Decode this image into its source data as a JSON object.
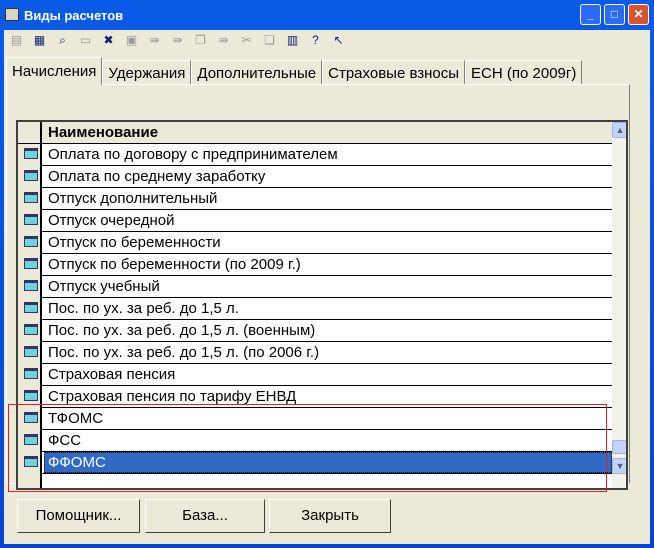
{
  "window": {
    "title": "Виды расчетов",
    "min": "_",
    "max": "□",
    "close": "✕"
  },
  "toolbar": [
    "new-icon",
    "edit-icon",
    "find-icon",
    "add-icon",
    "delete-icon",
    "copy-icon",
    "move-icon",
    "move-group-icon",
    "group-icon",
    "move-to-icon",
    "unlink-icon",
    "paste-icon",
    "print-icon",
    "help-icon",
    "whats-this-icon"
  ],
  "tabs": [
    "Начисления",
    "Удержания",
    "Дополнительные",
    "Страховые взносы",
    "ЕСН (по 2009г)"
  ],
  "grid": {
    "header": "Наименование",
    "rows": [
      "Оплата по договору с предпринимателем",
      "Оплата по среднему заработку",
      "Отпуск дополнительный",
      "Отпуск очередной",
      "Отпуск по беременности",
      "Отпуск по беременности (по 2009 г.)",
      "Отпуск учебный",
      "Пос. по ух. за реб. до 1,5 л.",
      "Пос. по ух. за реб. до 1,5 л. (военным)",
      "Пос. по ух. за реб. до 1,5 л. (по 2006 г.)",
      "Страховая пенсия",
      "Страховая пенсия по тарифу ЕНВД",
      "ТФОМС",
      "ФСС",
      "ФФОМС"
    ],
    "selected": "ФФОМС"
  },
  "buttons": {
    "helper": "Помощник...",
    "base": "База...",
    "close": "Закрыть"
  }
}
